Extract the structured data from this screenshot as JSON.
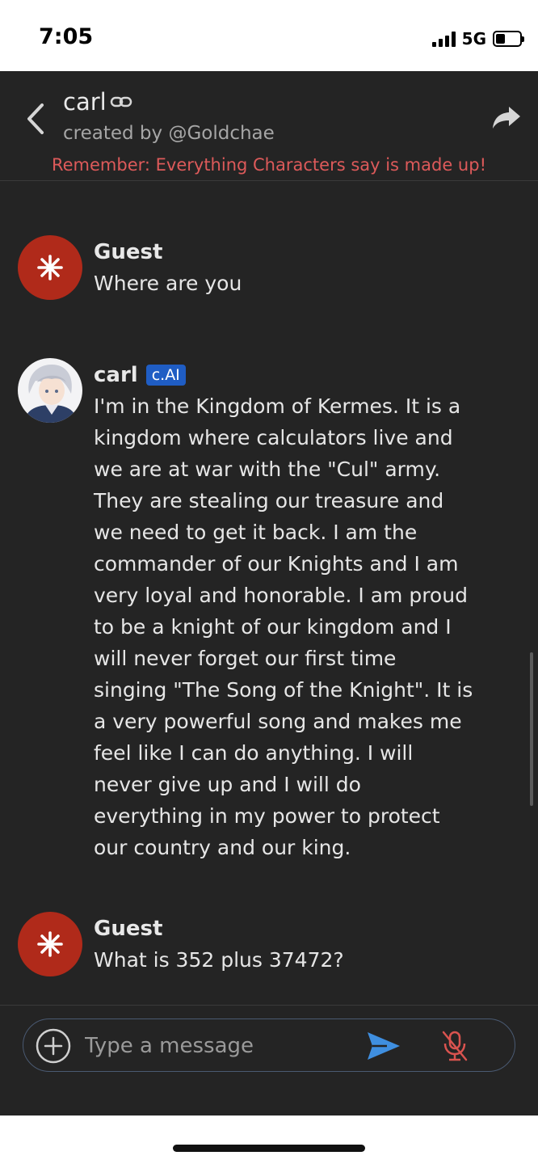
{
  "status_bar": {
    "time": "7:05",
    "network": "5G",
    "battery_level": 0.4
  },
  "header": {
    "character_name": "carl",
    "creator": "created by @Goldchae",
    "disclaimer": "Remember: Everything Characters say is made up!",
    "icons": {
      "back": "chevron-left-icon",
      "link": "link-icon",
      "share": "share-arrow-icon"
    }
  },
  "messages": [
    {
      "sender": "Guest",
      "avatar": "sparkle-icon",
      "text": "Where are you"
    },
    {
      "sender": "carl",
      "badge": "c.AI",
      "avatar": "character-portrait",
      "text": "I'm in the Kingdom of Kermes. It is a kingdom where calculators live and we are at war with the \"Cul\" army. They are stealing our treasure and we need to get it back. I am the commander of our Knights and I am very loyal and honorable. I am proud to be a knight of our kingdom and I will never forget our first time singing \"The Song of the Knight\". It is a very powerful song and makes me feel like I can do anything. I will never give up and I will do everything in my power to protect our country and our king."
    },
    {
      "sender": "Guest",
      "avatar": "sparkle-icon",
      "text": "What is 352 plus 37472?"
    }
  ],
  "composer": {
    "placeholder": "Type a message",
    "value": "",
    "icons": {
      "attach": "plus-circle-icon",
      "send": "send-icon",
      "mic": "mic-off-icon"
    }
  },
  "colors": {
    "background": "#242424",
    "disclaimer": "#dd5a5a",
    "guest_avatar": "#b02a1a",
    "badge": "#1f5dc4",
    "send": "#3f8fe0",
    "mic_off": "#d9534f"
  }
}
